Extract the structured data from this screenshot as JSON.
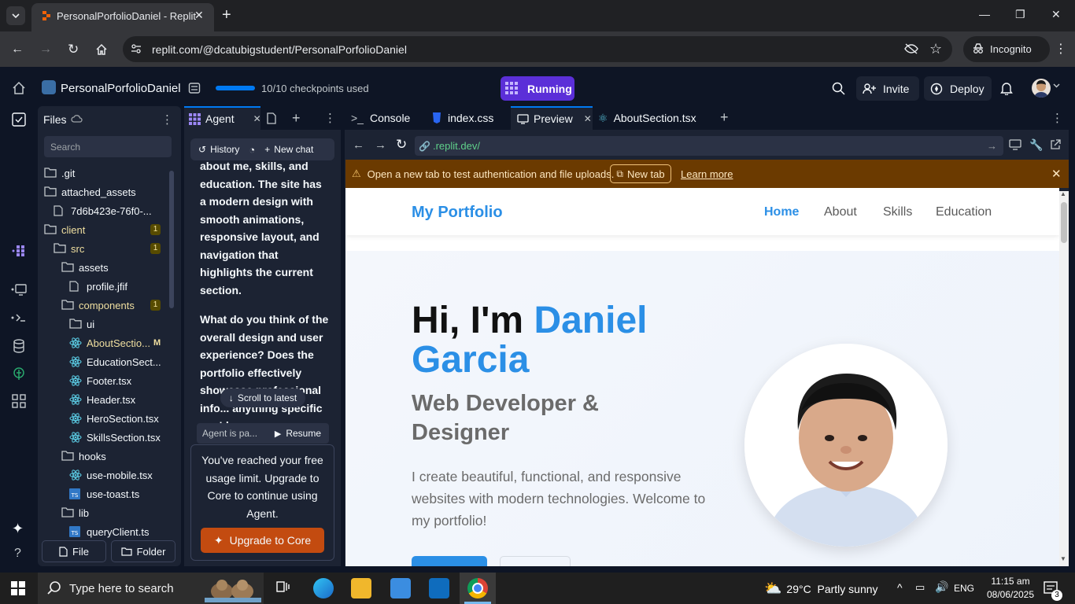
{
  "browser": {
    "tab_title": "PersonalPorfolioDaniel - Replit",
    "url": "replit.com/@dcatubigstudent/PersonalPorfolioDaniel",
    "incognito_label": "Incognito"
  },
  "replit": {
    "project_name": "PersonalPorfolioDaniel",
    "checkpoints": "10/10 checkpoints used",
    "run_status": "Running",
    "invite_label": "Invite",
    "deploy_label": "Deploy"
  },
  "files": {
    "title": "Files",
    "search_placeholder": "Search",
    "tree": [
      {
        "name": ".git",
        "type": "folder",
        "depth": 0
      },
      {
        "name": "attached_assets",
        "type": "folder",
        "depth": 0
      },
      {
        "name": "7d6b423e-76f0-...",
        "type": "file",
        "depth": 1
      },
      {
        "name": "client",
        "type": "folder",
        "depth": 0,
        "badge": "1"
      },
      {
        "name": "src",
        "type": "folder",
        "depth": 1,
        "badge": "1"
      },
      {
        "name": "assets",
        "type": "folder",
        "depth": 2
      },
      {
        "name": "profile.jfif",
        "type": "file",
        "depth": 3
      },
      {
        "name": "components",
        "type": "folder",
        "depth": 2,
        "badge": "1"
      },
      {
        "name": "ui",
        "type": "folder",
        "depth": 3
      },
      {
        "name": "AboutSectio...",
        "type": "react",
        "depth": 3,
        "mod": "M"
      },
      {
        "name": "EducationSect...",
        "type": "react",
        "depth": 3
      },
      {
        "name": "Footer.tsx",
        "type": "react",
        "depth": 3
      },
      {
        "name": "Header.tsx",
        "type": "react",
        "depth": 3
      },
      {
        "name": "HeroSection.tsx",
        "type": "react",
        "depth": 3
      },
      {
        "name": "SkillsSection.tsx",
        "type": "react",
        "depth": 3
      },
      {
        "name": "hooks",
        "type": "folder",
        "depth": 2
      },
      {
        "name": "use-mobile.tsx",
        "type": "react",
        "depth": 3
      },
      {
        "name": "use-toast.ts",
        "type": "ts",
        "depth": 3
      },
      {
        "name": "lib",
        "type": "folder",
        "depth": 2
      },
      {
        "name": "queryClient.ts",
        "type": "ts",
        "depth": 3
      }
    ],
    "file_button": "File",
    "folder_button": "Folder"
  },
  "agent": {
    "tab_label": "Agent",
    "history_label": "History",
    "new_chat_label": "New chat",
    "message_p1": "about me, skills, and education. The site has a modern design with smooth animations, responsive layout, and navigation that highlights the current section.",
    "message_p2": "What do you think of the overall design and user experience? Does the portfolio effectively showcase professional info... anything specific you'd",
    "scroll_latest": "Scroll to latest",
    "paused_text": "Agent is pa...",
    "resume_label": "Resume",
    "limit_text": "You've reached your free usage limit. Upgrade to Core to continue using Agent.",
    "upgrade_label": "Upgrade to Core"
  },
  "workspace": {
    "tabs": [
      "Console",
      "index.css",
      "Preview",
      "AboutSection.tsx"
    ],
    "preview_url": ".replit.dev/",
    "warning": "Open a new tab to test authentication and file uploads.",
    "new_tab_label": "New tab",
    "learn_more": "Learn more"
  },
  "site": {
    "brand": "My Portfolio",
    "nav": [
      "Home",
      "About",
      "Skills",
      "Education"
    ],
    "hero_greeting": "Hi, I'm ",
    "hero_name_1": "Daniel",
    "hero_name_2": "Garcia",
    "subtitle_1": "Web Developer &",
    "subtitle_2": "Designer",
    "description": "I create beautiful, functional, and responsive websites with modern technologies. Welcome to my portfolio!"
  },
  "taskbar": {
    "search_placeholder": "Type here to search",
    "weather": "29°C  Partly sunny",
    "lang": "ENG",
    "time": "11:15 am",
    "date": "08/06/2025",
    "notifications": "3"
  },
  "colors": {
    "accent": "#0079f2",
    "run": "#5b2fd8",
    "site_blue": "#2b8fe6",
    "upgrade": "#c34b10"
  }
}
